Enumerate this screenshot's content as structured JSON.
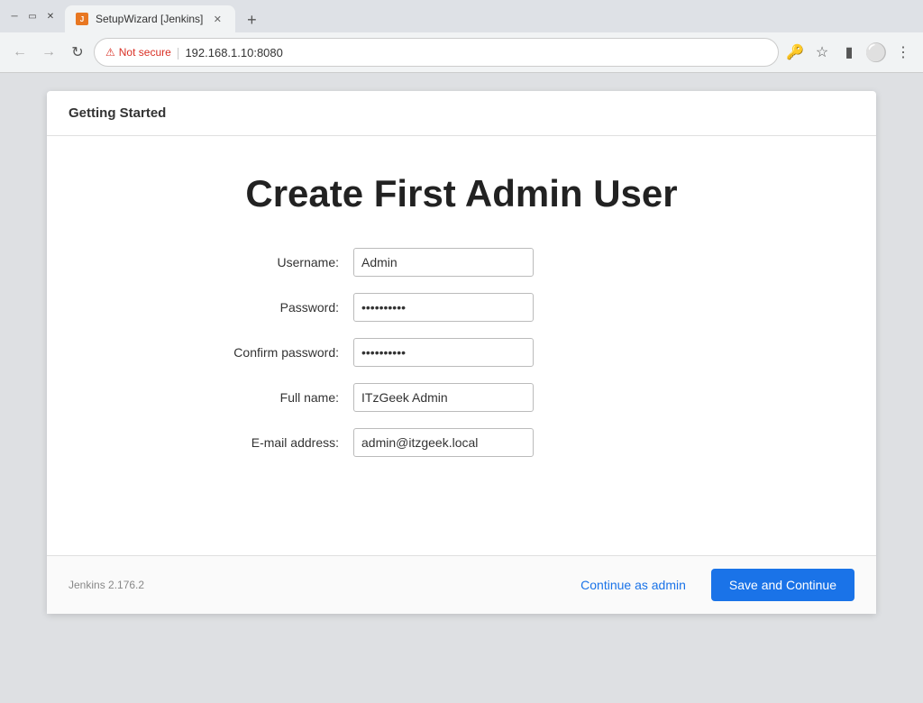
{
  "browser": {
    "tab_title": "SetupWizard [Jenkins]",
    "address": "192.168.1.10:8080",
    "not_secure_label": "Not secure",
    "new_tab_label": "+",
    "back_icon": "←",
    "forward_icon": "→",
    "reload_icon": "↻"
  },
  "wizard": {
    "header_title": "Getting Started",
    "form_title": "Create First Admin User",
    "fields": {
      "username_label": "Username:",
      "username_value": "Admin",
      "password_label": "Password:",
      "password_value": "••••••••••",
      "confirm_password_label": "Confirm password:",
      "confirm_password_value": "••••••••••",
      "fullname_label": "Full name:",
      "fullname_value": "ITzGeek Admin",
      "email_label": "E-mail address:",
      "email_value": "admin@itzgeek.local"
    },
    "footer": {
      "version": "Jenkins 2.176.2",
      "continue_as_admin": "Continue as admin",
      "save_and_continue": "Save and Continue"
    }
  }
}
